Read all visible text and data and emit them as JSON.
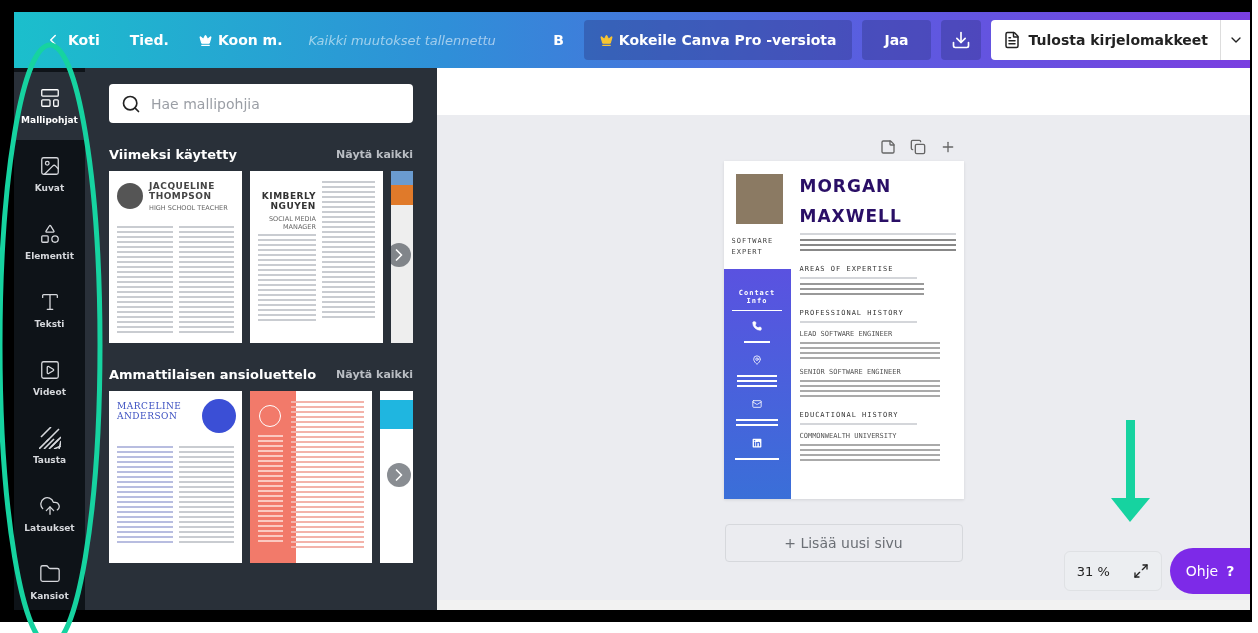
{
  "topbar": {
    "back": "Koti",
    "menu": [
      {
        "label": "Tied.",
        "crown": false
      },
      {
        "label": "Koon m.",
        "crown": true
      }
    ],
    "status": "Kaikki muutokset tallennettu",
    "badge": "B",
    "pro": "Kokeile Canva Pro -versiota",
    "share": "Jaa",
    "print": "Tulosta kirjelomakkeet"
  },
  "rail": [
    {
      "label": "Mallipohjat",
      "kind": "templates",
      "selected": true
    },
    {
      "label": "Kuvat",
      "kind": "photos",
      "selected": false
    },
    {
      "label": "Elementit",
      "kind": "elements",
      "selected": false
    },
    {
      "label": "Teksti",
      "kind": "text",
      "selected": false
    },
    {
      "label": "Videot",
      "kind": "videos",
      "selected": false
    },
    {
      "label": "Tausta",
      "kind": "background",
      "selected": false
    },
    {
      "label": "Lataukset",
      "kind": "uploads",
      "selected": false
    },
    {
      "label": "Kansiot",
      "kind": "folders",
      "selected": false
    }
  ],
  "panel": {
    "search": {
      "placeholder": "Hae mallipohjia"
    },
    "sections": [
      {
        "title": "Viimeksi käytetty",
        "link": "Näytä kaikki",
        "templates": [
          {
            "kind": "portrait",
            "name": "JACQUELINE THOMPSON",
            "subtitle": "HIGH SCHOOL TEACHER"
          },
          {
            "kind": "two-column",
            "name": "KIMBERLY NGUYEN",
            "subtitle": "SOCIAL MEDIA MANAGER"
          },
          {
            "kind": "partial-orange"
          }
        ]
      },
      {
        "title": "Ammattilaisen ansioluettelo",
        "link": "Näytä kaikki",
        "templates": [
          {
            "kind": "circle-accent",
            "name": "MARCELINE ANDERSON"
          },
          {
            "kind": "coral"
          },
          {
            "kind": "partial-blue"
          }
        ]
      }
    ]
  },
  "resume": {
    "name": [
      "MORGAN",
      "MAXWELL"
    ],
    "title": [
      "SOFTWARE",
      "EXPERT"
    ],
    "contact": "Contact Info",
    "sections": [
      {
        "heading": "AREAS OF EXPERTISE"
      },
      {
        "heading": "PROFESSIONAL HISTORY",
        "jobs": [
          "LEAD SOFTWARE ENGINEER",
          "SENIOR SOFTWARE ENGINEER"
        ]
      },
      {
        "heading": "EDUCATIONAL HISTORY",
        "jobs": [
          "COMMONWEALTH UNIVERSITY"
        ]
      }
    ]
  },
  "add_page": "+ Lisää uusi sivu",
  "zoom": "31 %",
  "help": {
    "label": "Ohje",
    "mark": "?"
  }
}
